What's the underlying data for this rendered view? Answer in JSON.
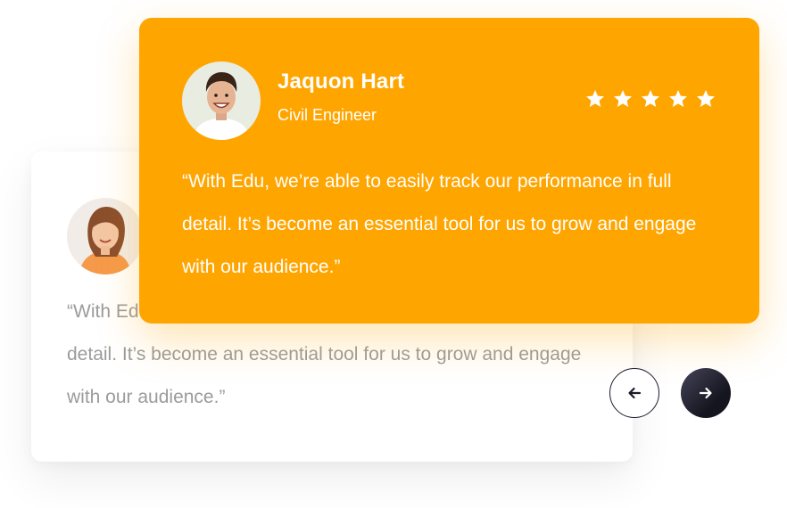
{
  "testimonials": {
    "back": {
      "quote": "“With Edu, we’re able to easily track our performance in full detail. It’s become an essential tool for us to grow and engage with our audience.”"
    },
    "front": {
      "name": "Jaquon Hart",
      "role": "Civil Engineer",
      "rating": 5,
      "rating_max": 5,
      "quote": "“With Edu, we’re able to easily track our performance in full detail. It’s become an essential tool for us to grow and engage with our audience.”"
    }
  },
  "icons": {
    "star": "star-icon",
    "prev": "arrow-left-icon",
    "next": "arrow-right-icon"
  },
  "colors": {
    "accent": "#ffa500",
    "text_on_accent": "#ffffff",
    "muted_text": "#9b9b9b",
    "nav_dark": "#1b1b2a"
  }
}
